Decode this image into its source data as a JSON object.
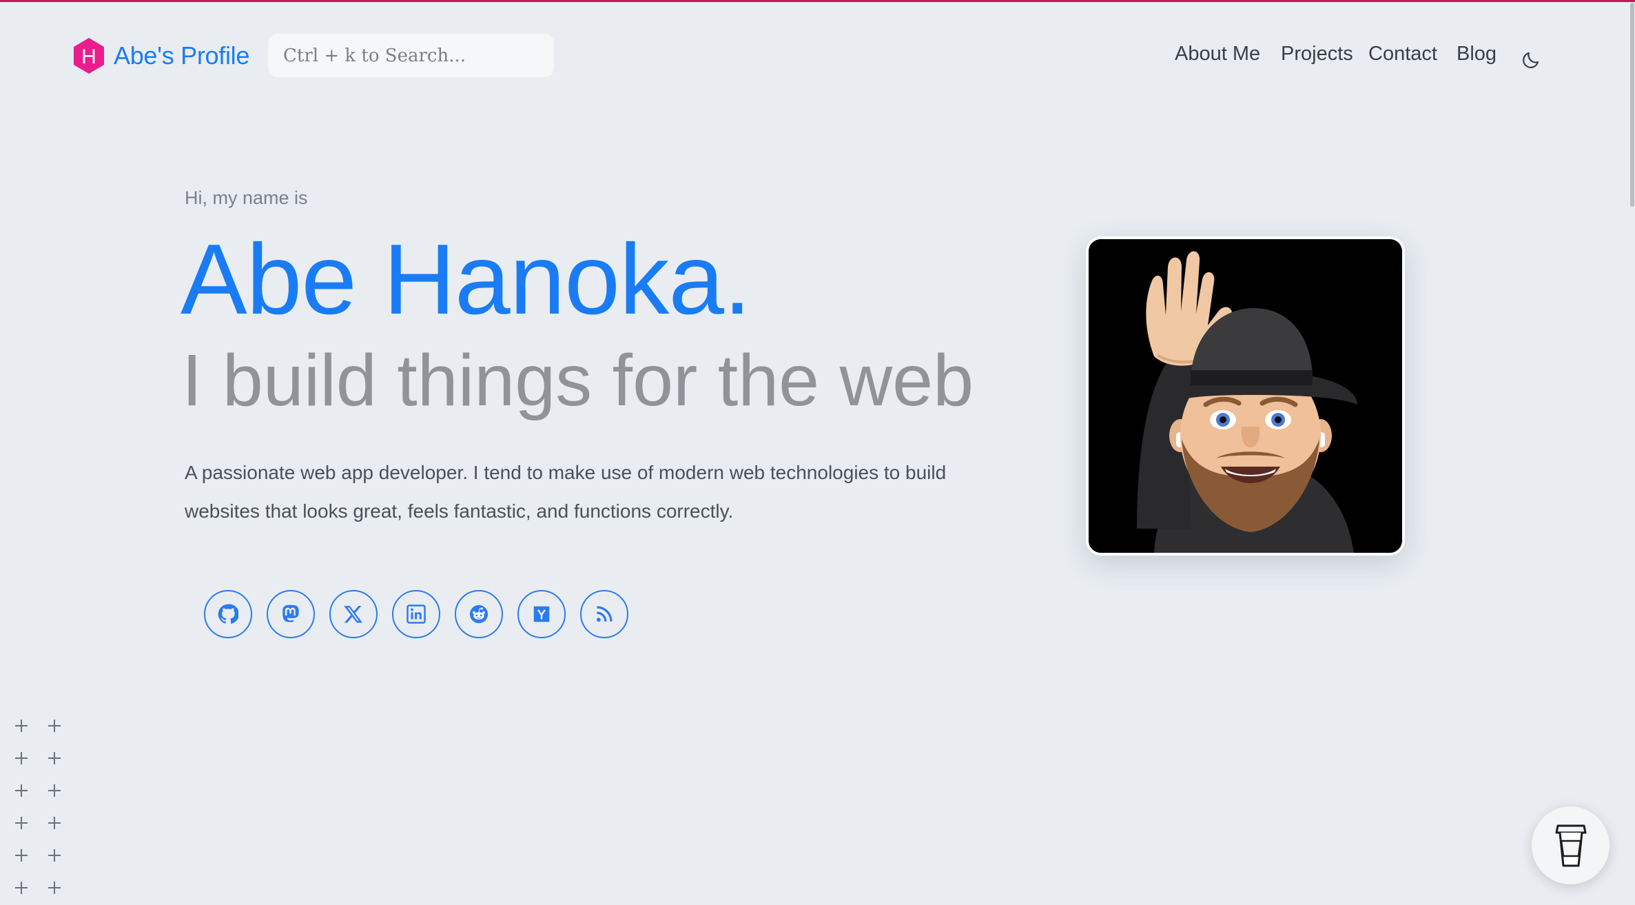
{
  "header": {
    "logo_text": "Abe's Profile",
    "logo_letter": "H",
    "search": {
      "placeholder": "Ctrl + k to Search..."
    },
    "nav": [
      "About Me",
      "Projects",
      "Contact",
      "Blog"
    ]
  },
  "hero": {
    "greeting": "Hi, my name is",
    "name": "Abe Hanoka.",
    "tagline": "I build things for the web",
    "bio": "A passionate web app developer. I tend to make use of modern web technologies to build websites that looks great, feels fantastic, and functions correctly."
  },
  "socials": [
    "github-icon",
    "mastodon-icon",
    "x-icon",
    "linkedin-icon",
    "reddit-icon",
    "hacker-news-icon",
    "rss-icon"
  ],
  "colors": {
    "accent": "#1a7cf5",
    "logo": "#e91e8c",
    "background": "#e9edf1",
    "top_bar": "#c2185b"
  }
}
